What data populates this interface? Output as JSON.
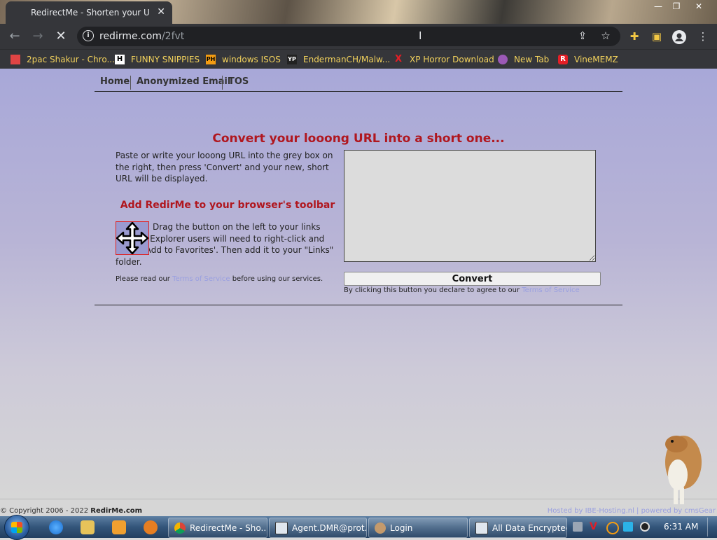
{
  "browser": {
    "tab_title": "RedirectMe - Shorten your URL f",
    "url_host": "redirme.com",
    "url_path": "/2fvt",
    "bookmarks": [
      {
        "label": "2pac Shakur - Chro...",
        "color": "#e04444"
      },
      {
        "label": "FUNNY SNIPPIES",
        "color": "#222222",
        "glyph": "H"
      },
      {
        "label": "windows ISOS",
        "color": "#f39c12",
        "glyph": "PH"
      },
      {
        "label": "EndermanCH/Malw...",
        "color": "#222222",
        "glyph": "YP"
      },
      {
        "label": "XP Horror Download",
        "color": "#e41e26",
        "glyph": "X"
      },
      {
        "label": "New Tab",
        "color": "#9b59b6"
      },
      {
        "label": "VineMEMZ",
        "color": "#e41e26",
        "glyph": "R"
      }
    ]
  },
  "site": {
    "nav": [
      "Home",
      "Anonymized Email",
      "TOS"
    ],
    "headline": "Convert your looong URL into a short one...",
    "intro": "Paste or write your looong URL into the grey box on the right, then press 'Convert' and your new, short URL will be displayed.",
    "toolbar_heading": "Add RedirMe to your browser's toolbar",
    "drag_text": "Drag the button on the left to your links toolbar. Explorer users will need to right-click and select 'Add to Favorites'. Then add it to your \"Links\" folder.",
    "tos_prefix": "Please read our",
    "tos_link": "Terms of Service",
    "tos_suffix": "before using our services.",
    "convert_label": "Convert",
    "consent_prefix": "By clicking this button you declare to agree to our",
    "consent_link": "Terms of Service",
    "copyright_prefix": "© Copyright 2006 - 2022",
    "copyright_brand": "RedirMe.com",
    "hosted_text": "Hosted by IBE-Hosting.nl  |  powered by cmsGear"
  },
  "taskbar": {
    "buttons": [
      "RedirectMe - Sho...",
      "Agent.DMR@prot...",
      "Login",
      "All Data Encrypted"
    ],
    "clock": "6:31 AM"
  },
  "colors": {
    "accent_red": "#b0171f",
    "link_lavender": "#9aa0e0",
    "bookmark_text": "#f1d15c"
  }
}
